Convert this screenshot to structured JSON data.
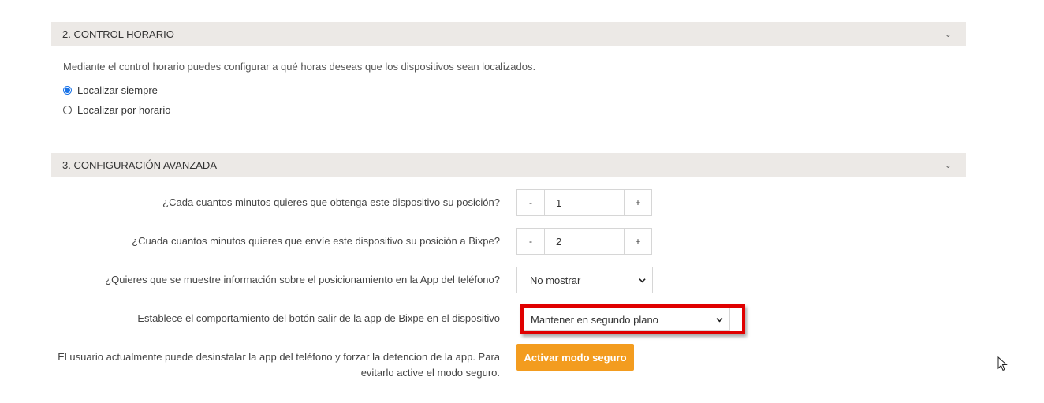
{
  "section2": {
    "title": "2. CONTROL HORARIO",
    "description": "Mediante el control horario puedes configurar a qué horas deseas que los dispositivos sean localizados.",
    "options": [
      {
        "label": "Localizar siempre",
        "checked": true
      },
      {
        "label": "Localizar por horario",
        "checked": false
      }
    ]
  },
  "section3": {
    "title": "3. CONFIGURACIÓN AVANZADA",
    "q1": {
      "label": "¿Cada cuantos minutos quieres que obtenga este dispositivo su posición?",
      "value": "1",
      "minus": "-",
      "plus": "+"
    },
    "q2": {
      "label": "¿Cuada cuantos minutos quieres que envíe este dispositivo su posición a Bixpe?",
      "value": "2",
      "minus": "-",
      "plus": "+"
    },
    "q3": {
      "label": "¿Quieres que se muestre información sobre el posicionamiento en la App del teléfono?",
      "selected": "No mostrar"
    },
    "q4": {
      "label": "Establece el comportamiento del botón salir de la app de Bixpe en el dispositivo",
      "selected": "Mantener en segundo plano"
    },
    "safe_mode": {
      "text_line1": "El usuario actualmente puede desinstalar la app del teléfono y forzar la detencion de la app. Para",
      "text_line2": "evitarlo active el modo seguro.",
      "button_label": "Activar modo seguro"
    }
  },
  "colors": {
    "header_bg": "#ece9e6",
    "accent": "#f39c1f",
    "highlight": "#e00000",
    "radio": "#1a73e8"
  }
}
